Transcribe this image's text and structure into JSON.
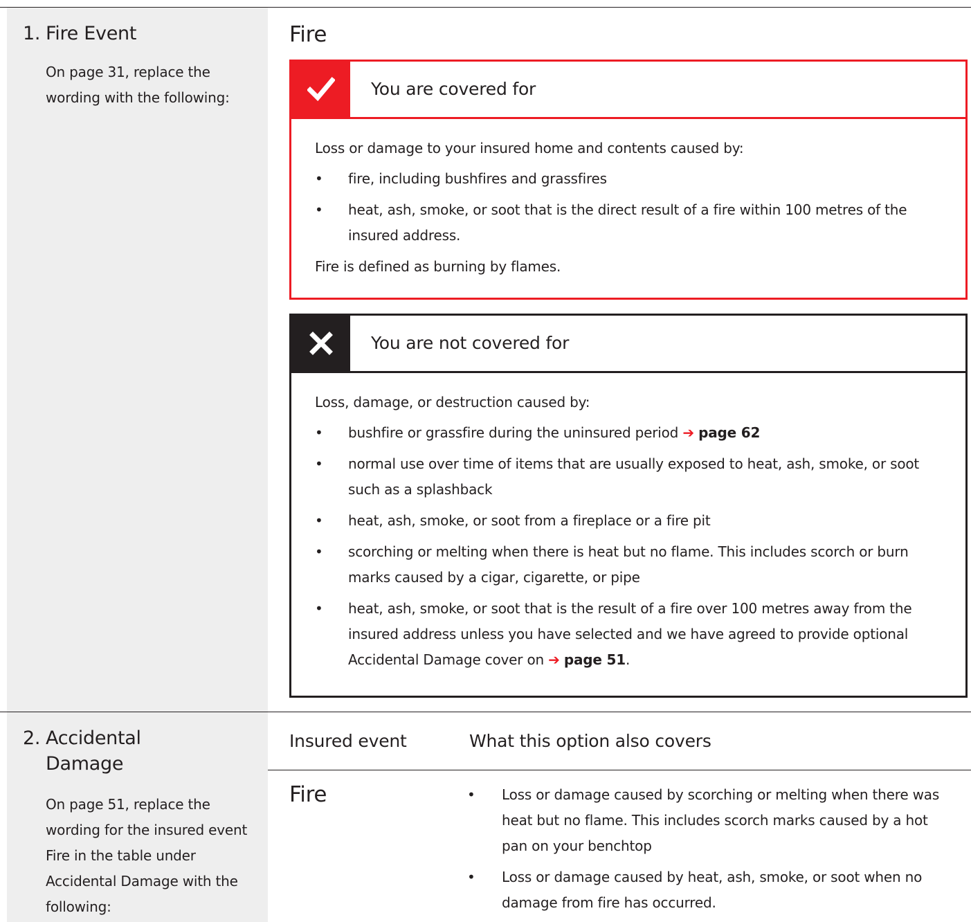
{
  "section1": {
    "number": "1.",
    "title": "Fire Event",
    "body": "On page 31, replace the wording with the following:"
  },
  "heading": "Fire",
  "covered": {
    "title": "You are covered for",
    "icon": "check-icon",
    "accent": "#ed1c24",
    "intro": "Loss or damage to your insured home and contents caused by:",
    "items": [
      "fire, including bushfires and grassfires",
      "heat, ash, smoke, or soot that is the direct result of a fire within 100 metres of the insured address."
    ],
    "footer": "Fire is defined as burning by flames."
  },
  "not_covered": {
    "title": "You are not covered for",
    "icon": "cross-icon",
    "accent": "#231f20",
    "intro": "Loss, damage, or destruction caused by:",
    "item1_text": "bushfire or grassfire during the uninsured period",
    "item1_ref": "page 62",
    "item2": "normal use over time of items that are usually exposed to heat, ash, smoke, or soot such as a splashback",
    "item3": "heat, ash, smoke, or soot from a fireplace or a fire pit",
    "item4": "scorching or melting when there is heat but no flame. This includes scorch or burn marks caused by a cigar, cigarette, or pipe",
    "item5_text": "heat, ash, smoke, or soot that is the result of a fire over 100 metres away from the insured address unless you have selected and we have agreed to provide optional Accidental Damage cover on",
    "item5_ref": "page 51",
    "item5_end": "."
  },
  "section2": {
    "number": "2.",
    "title_line1": "Accidental",
    "title_line2": "Damage",
    "body": "On page 51, replace the wording for the insured event Fire in the table under Accidental Damage with the following:"
  },
  "table": {
    "col1_header": "Insured event",
    "col2_header": "What this option also covers",
    "row_event": "Fire",
    "row_items": [
      "Loss or damage caused by scorching or melting when there was heat but no flame. This includes scorch marks caused by a hot pan on your benchtop",
      "Loss or damage caused by heat, ash, smoke, or soot when no damage from fire has occurred."
    ]
  },
  "bullet": "•",
  "arrow": "➔"
}
